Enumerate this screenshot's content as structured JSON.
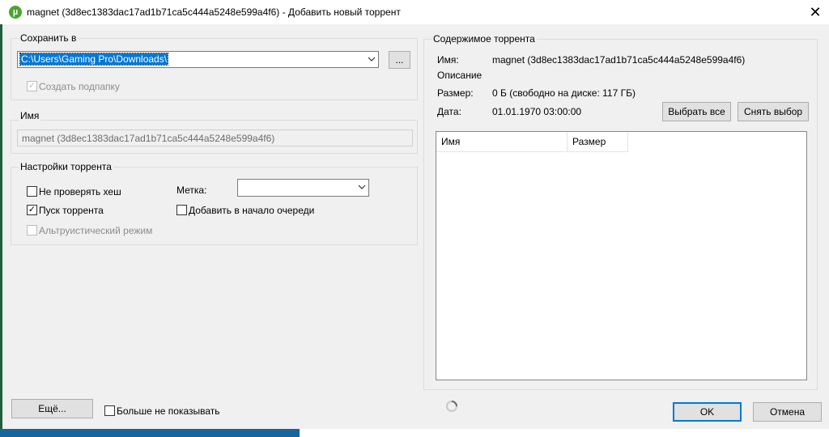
{
  "window": {
    "title": "magnet (3d8ec1383dac17ad1b71ca5c444a5248e599a4f6) - Добавить новый торрент",
    "close_glyph": "✕",
    "app_icon": "utorrent-icon"
  },
  "save": {
    "group_label": "Сохранить в",
    "path": "C:\\Users\\Gaming Pro\\Downloads\\",
    "browse_label": "...",
    "subfolder_label": "Создать подпапку",
    "subfolder_checked": true
  },
  "name": {
    "group_label": "Имя",
    "value": "magnet (3d8ec1383dac17ad1b71ca5c444a5248e599a4f6)"
  },
  "settings": {
    "group_label": "Настройки торрента",
    "skip_hash_label": "Не проверять хеш",
    "skip_hash_checked": false,
    "start_label": "Пуск торрента",
    "start_checked": true,
    "altruistic_label": "Альтруистический режим",
    "altruistic_checked": false,
    "tag_label": "Метка:",
    "tag_value": "",
    "add_top_label": "Добавить в начало очереди",
    "add_top_checked": false
  },
  "contents": {
    "group_label": "Содержимое торрента",
    "name_label": "Имя:",
    "name_value": "magnet (3d8ec1383dac17ad1b71ca5c444a5248e599a4f6)",
    "description_label": "Описание",
    "size_label": "Размер:",
    "size_value": "0 Б (свободно на диске: 117 ГБ)",
    "date_label": "Дата:",
    "date_value": "01.01.1970 03:00:00",
    "select_all_label": "Выбрать все",
    "deselect_label": "Снять выбор",
    "columns": [
      "Имя",
      "Размер"
    ]
  },
  "footer": {
    "more_label": "Ещё...",
    "dont_show_label": "Больше не показывать",
    "dont_show_checked": false,
    "ok_label": "OK",
    "cancel_label": "Отмена"
  },
  "colors": {
    "accent": "#0078d7",
    "app_icon": "#4aa52e"
  }
}
